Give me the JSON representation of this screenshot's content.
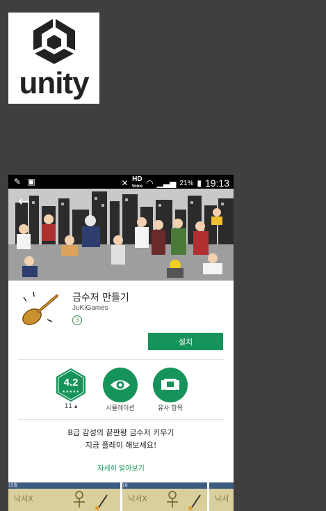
{
  "logo": {
    "wordmark": "unity"
  },
  "status_bar": {
    "network_label": "HD",
    "network_sub": "Voice",
    "battery": "21%",
    "time": "19:13"
  },
  "app": {
    "name": "금수저 만들기",
    "developer": "JuKiGames",
    "rating_badge": "3",
    "install_label": "설치"
  },
  "stats": [
    {
      "value": "4.2",
      "stars": "★★★★★",
      "label": "11 ▴",
      "type": "rating"
    },
    {
      "icon": "eye-icon",
      "label": "시뮬레이션",
      "type": "category"
    },
    {
      "icon": "similar-apps-icon",
      "label": "유사 항목",
      "type": "similar"
    }
  ],
  "description": {
    "line1": "B급 감성의 끝판왕 금수저 키우기",
    "line2": "지금 플레이 해보세요!",
    "more_label": "자세히 알아보기"
  },
  "screenshots": [
    {
      "bar": "15월",
      "text": "낙서X"
    },
    {
      "bar": "16",
      "text": "낙서X"
    },
    {
      "bar": "",
      "text": "낙서"
    }
  ],
  "colors": {
    "accent": "#16935a",
    "background": "#3f3f3f"
  }
}
